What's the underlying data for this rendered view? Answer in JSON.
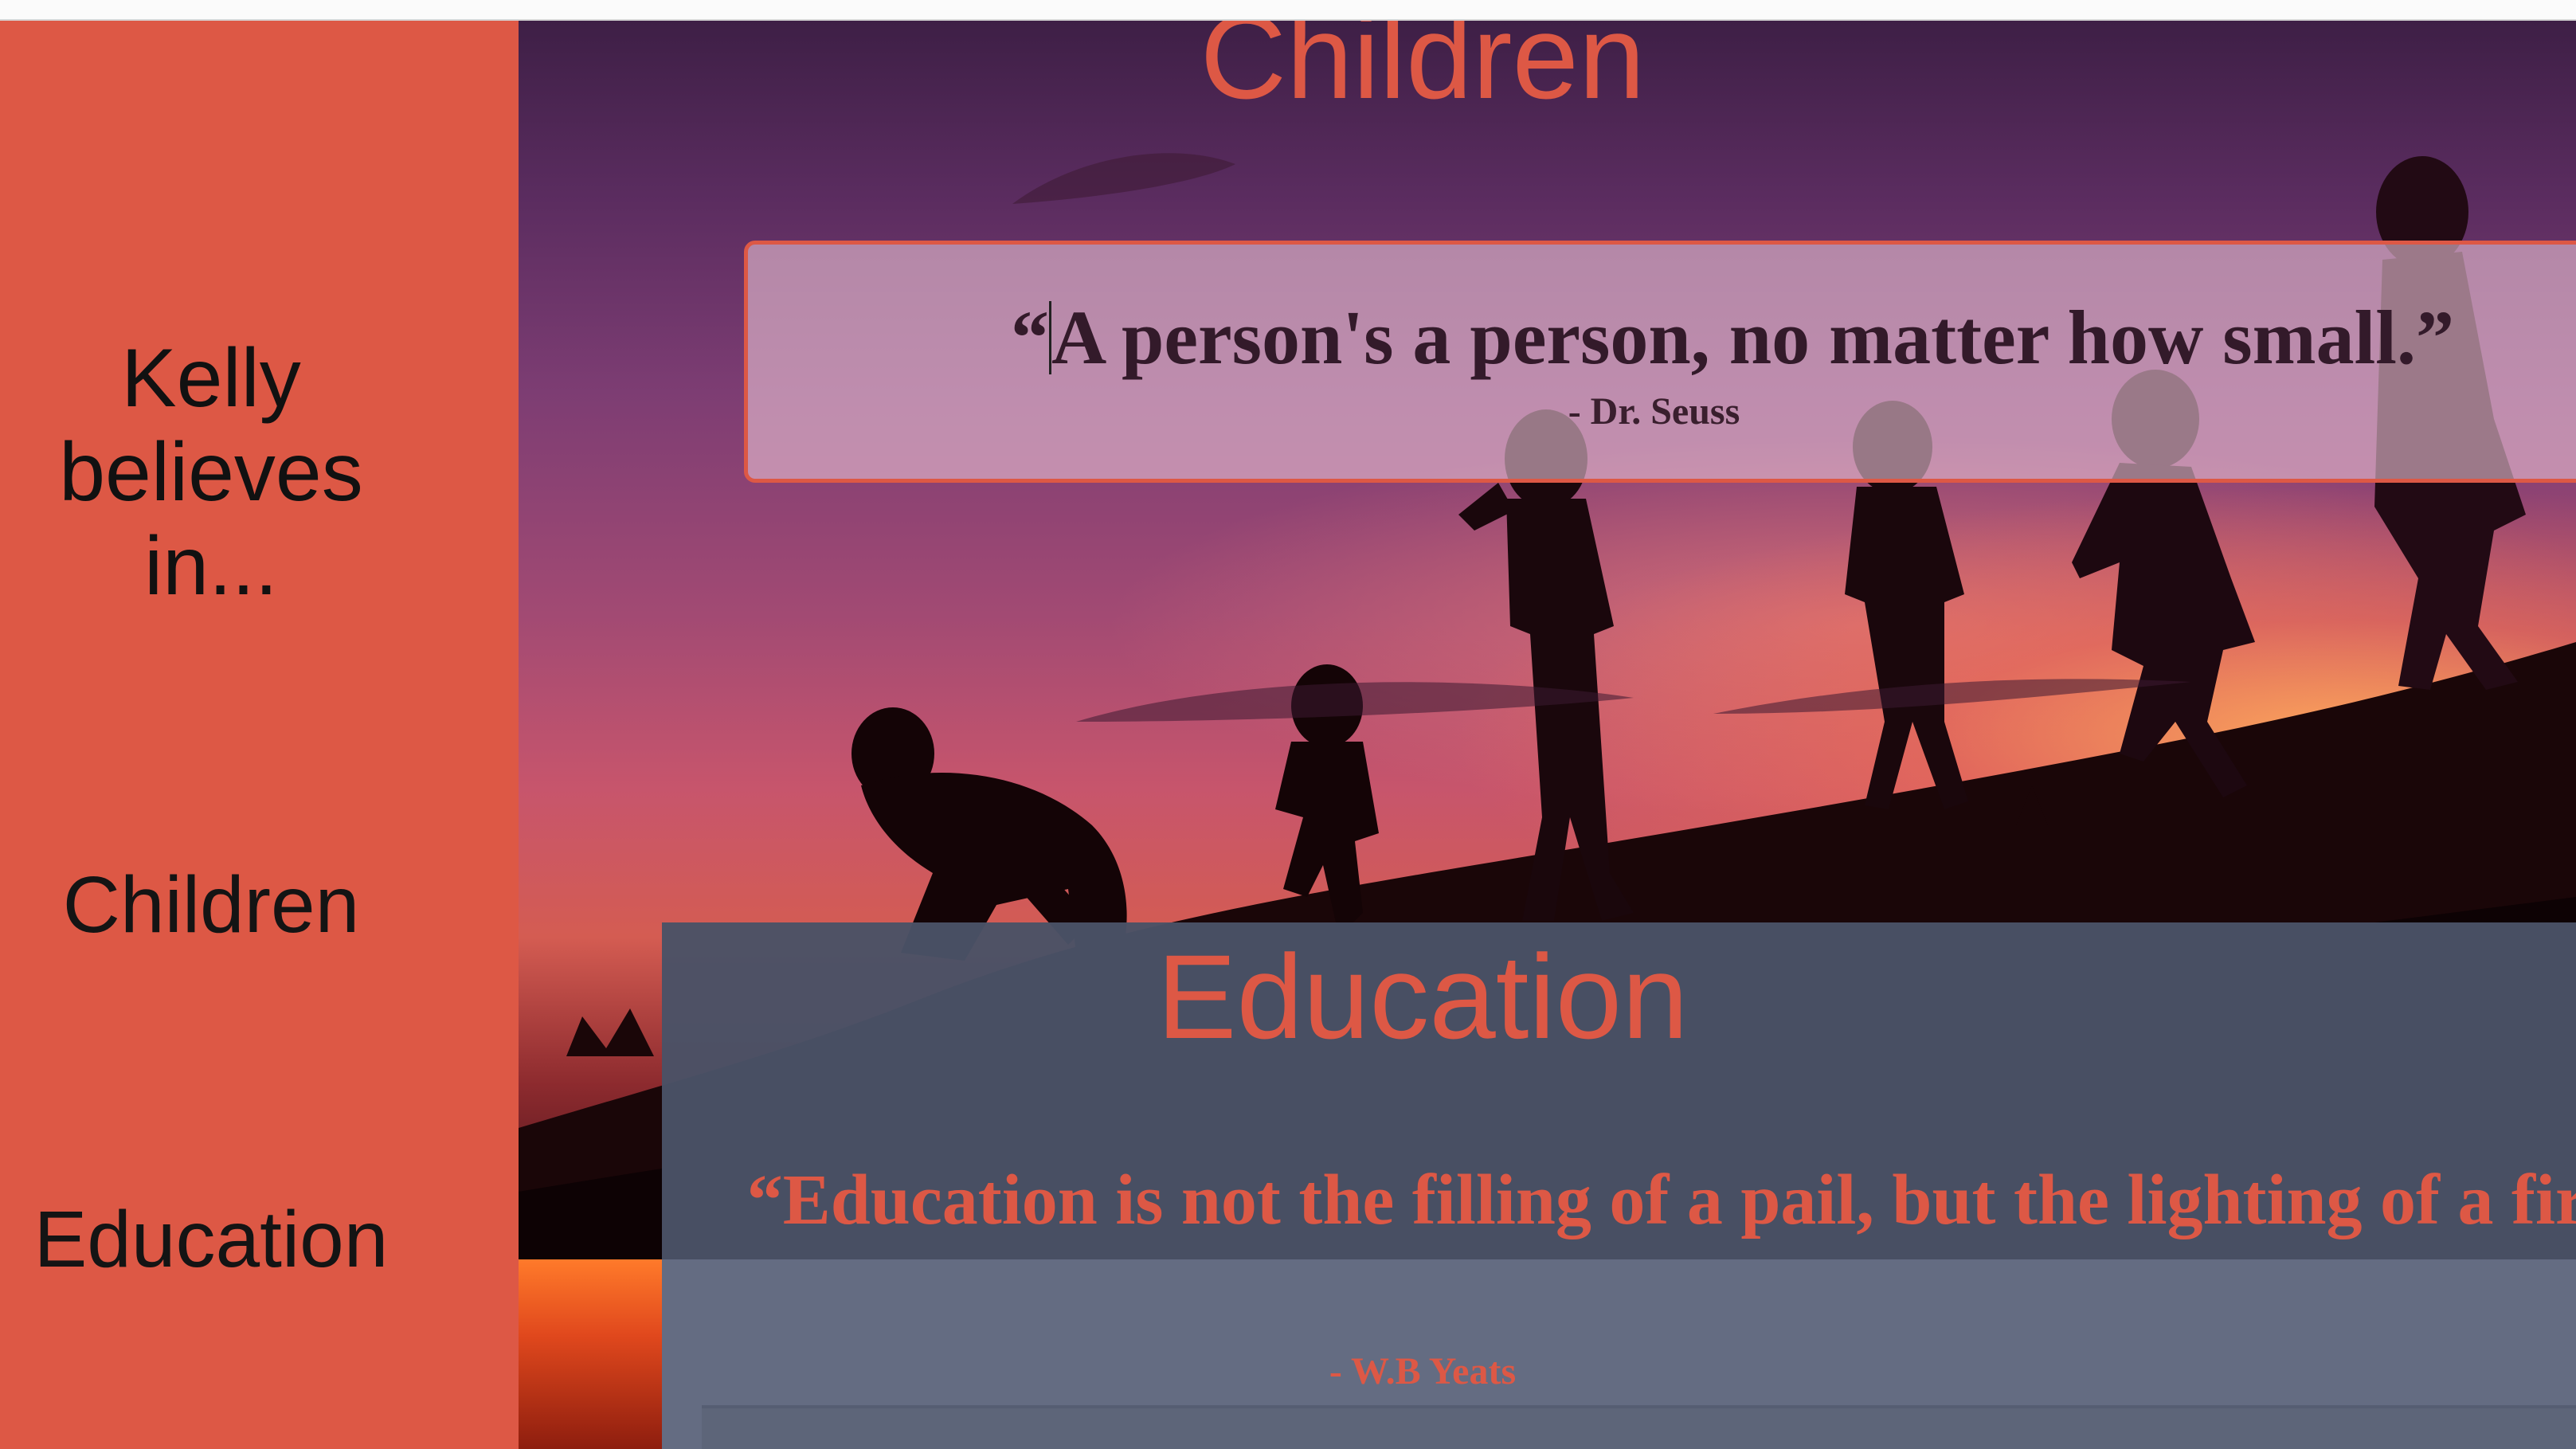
{
  "sidebar": {
    "title": "Kelly believes in...",
    "links": [
      "Children",
      "Education"
    ]
  },
  "children_section": {
    "heading": "Children",
    "quote_open": "“",
    "quote_body": "A person's a person, no matter how small.”",
    "author": "- Dr. Seuss"
  },
  "education_section": {
    "heading": "Education",
    "quote": "“Education is not the filling of a pail, but the lighting of a fire. ”",
    "author": "- W.B Yeats"
  },
  "colors": {
    "accent": "#dd5845",
    "panel": "#4a5266",
    "sidebar_text": "#111111"
  }
}
